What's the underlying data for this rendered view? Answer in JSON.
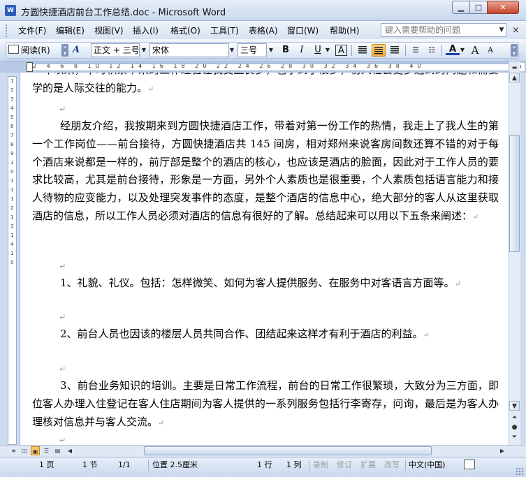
{
  "window": {
    "app_icon": "W",
    "title": "方圆快捷酒店前台工作总结.doc - Microsoft Word",
    "btn_min": "▁",
    "btn_max": "□",
    "btn_close": "✕"
  },
  "menubar": {
    "items": [
      "文件(F)",
      "编辑(E)",
      "视图(V)",
      "插入(I)",
      "格式(O)",
      "工具(T)",
      "表格(A)",
      "窗口(W)",
      "帮助(H)"
    ],
    "help_placeholder": "键入需要帮助的问题",
    "close_glyph": "×"
  },
  "toolbar": {
    "read_label": "阅读(R)",
    "style_icon": "A",
    "style_value": "正文 + 三号",
    "font_value": "宋体",
    "size_value": "三号",
    "bold": "B",
    "italic": "I",
    "underline": "U",
    "char_border": "A",
    "font_color": "A",
    "grow_font": "A",
    "shrink_font": "A",
    "active_alignment": "center"
  },
  "ruler": {
    "numbers": "2 4 6 8 10 12 14 16 18 20 22 24 26 28 30 32 34 36 38 40",
    "end_label": "40"
  },
  "vruler": {
    "numbers": "1 2 3 4 5 6 7 8 9 10 11 12 13 14 15"
  },
  "document": {
    "para_top_partial": "一年以来，平时积累下来的工作经验让我受益良多，也学到了很多，初入社会更多遇到的问题和需要学的是人际交往的能力。",
    "para_mark": "↵",
    "para_intro": "经朋友介绍，我按期来到方圆快捷酒店工作，带着对第一份工作的热情，我走上了我人生的第一个工作岗位——前台接待，方圆快捷酒店共 145 间房，相对郑州来说客房间数还算不错的对于每个酒店来说都是一样的，前厅部是整个的酒店的核心，也应该是酒店的脸面，因此对于工作人员的要求比较高，尤其是前台接待，形象是一方面，另外个人素质也是很重要，个人素质包括语言能力和接人待物的应变能力，以及处理突发事件的态度，是整个酒店的信息中心，绝大部分的客人从这里获取酒店的信息，所以工作人员必须对酒店的信息有很好的了解。总结起来可以用以下五条来阐述：",
    "para_1": "1、礼貌、礼仪。包括：怎样微笑、如何为客人提供服务、在服务中对客语言方面等。",
    "para_2": "2、前台人员也因该的楼层人员共同合作、团结起来这样才有利于酒店的利益。",
    "para_3": "3、前台业务知识的培训。主要是日常工作流程，前台的日常工作很繁琐，大致分为三方面，即位客人办理入住登记在客人住店期间为客人提供的一系列服务包括行李寄存，问询，最后是为客人办理核对信息并与客人交流。"
  },
  "statusbar": {
    "page": "1 页",
    "section": "1 节",
    "page_of": "1/1",
    "position": "位置 2.5厘米",
    "line": "1 行",
    "column": "1 列",
    "rec": "录制",
    "trk": "修订",
    "ext": "扩展",
    "ovr": "改写",
    "language": "中文(中国)"
  }
}
